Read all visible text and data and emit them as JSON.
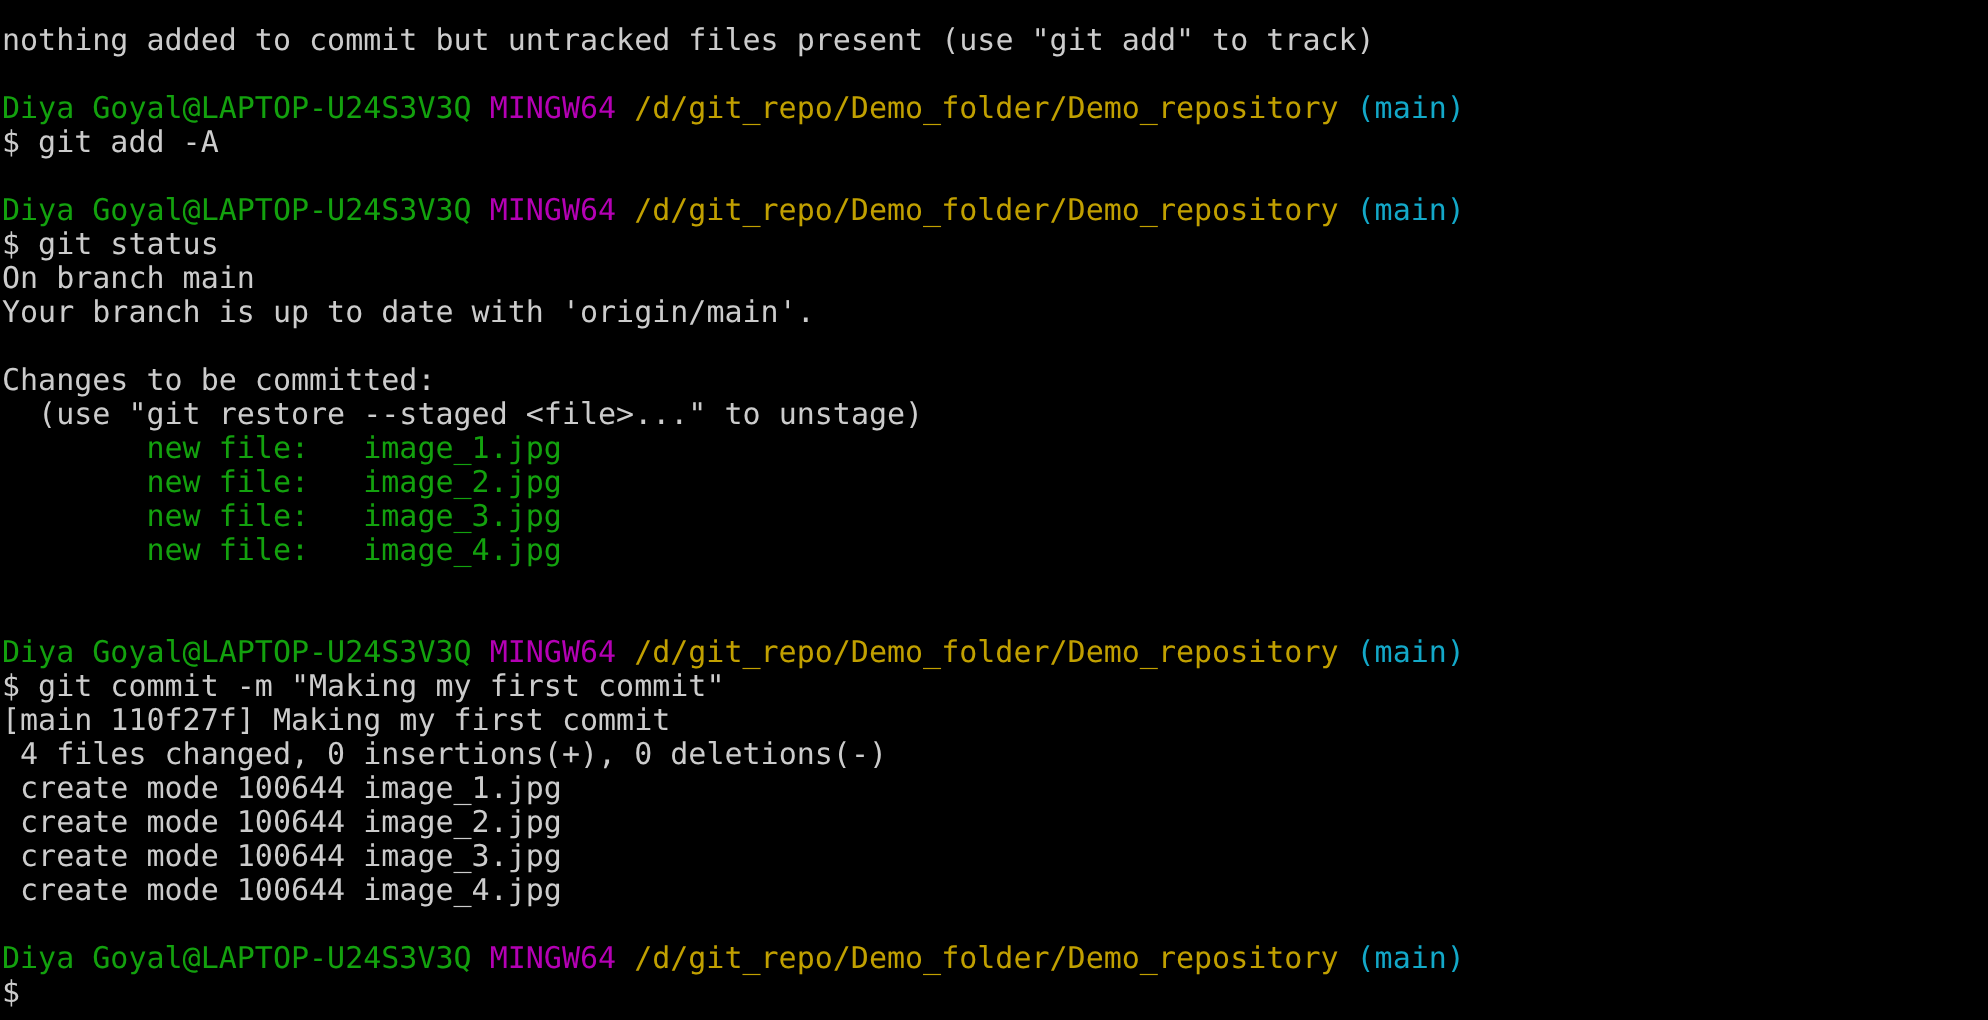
{
  "terminal": {
    "lines": [
      {
        "segments": [
          {
            "kind": "output",
            "text": "nothing added to commit but untracked files present (use \"git add\" to track)"
          }
        ]
      },
      {
        "kind": "blank"
      },
      {
        "segments": [
          {
            "kind": "user",
            "text": "Diya Goyal@LAPTOP-U24S3V3Q"
          },
          {
            "kind": "shell",
            "text": "MINGW64"
          },
          {
            "kind": "path",
            "text": "/d/git_repo/Demo_folder/Demo_repository"
          },
          {
            "kind": "branch",
            "text": "(main)"
          }
        ]
      },
      {
        "segments": [
          {
            "kind": "command",
            "text": "$ git add -A"
          }
        ]
      },
      {
        "kind": "blank"
      },
      {
        "segments": [
          {
            "kind": "user",
            "text": "Diya Goyal@LAPTOP-U24S3V3Q"
          },
          {
            "kind": "shell",
            "text": "MINGW64"
          },
          {
            "kind": "path",
            "text": "/d/git_repo/Demo_folder/Demo_repository"
          },
          {
            "kind": "branch",
            "text": "(main)"
          }
        ]
      },
      {
        "segments": [
          {
            "kind": "command",
            "text": "$ git status"
          }
        ]
      },
      {
        "segments": [
          {
            "kind": "output",
            "text": "On branch main"
          }
        ]
      },
      {
        "segments": [
          {
            "kind": "output",
            "text": "Your branch is up to date with 'origin/main'."
          }
        ]
      },
      {
        "kind": "blank"
      },
      {
        "segments": [
          {
            "kind": "output",
            "text": "Changes to be committed:"
          }
        ]
      },
      {
        "segments": [
          {
            "kind": "output",
            "text": "  (use \"git restore --staged <file>...\" to unstage)"
          }
        ]
      },
      {
        "segments": [
          {
            "kind": "staged",
            "text": "        new file:   image_1.jpg"
          }
        ]
      },
      {
        "segments": [
          {
            "kind": "staged",
            "text": "        new file:   image_2.jpg"
          }
        ]
      },
      {
        "segments": [
          {
            "kind": "staged",
            "text": "        new file:   image_3.jpg"
          }
        ]
      },
      {
        "segments": [
          {
            "kind": "staged",
            "text": "        new file:   image_4.jpg"
          }
        ]
      },
      {
        "kind": "blank"
      },
      {
        "kind": "blank"
      },
      {
        "segments": [
          {
            "kind": "user",
            "text": "Diya Goyal@LAPTOP-U24S3V3Q"
          },
          {
            "kind": "shell",
            "text": "MINGW64"
          },
          {
            "kind": "path",
            "text": "/d/git_repo/Demo_folder/Demo_repository"
          },
          {
            "kind": "branch",
            "text": "(main)"
          }
        ]
      },
      {
        "segments": [
          {
            "kind": "command",
            "text": "$ git commit -m \"Making my first commit\""
          }
        ]
      },
      {
        "segments": [
          {
            "kind": "output",
            "text": "[main 110f27f] Making my first commit"
          }
        ]
      },
      {
        "segments": [
          {
            "kind": "output",
            "text": " 4 files changed, 0 insertions(+), 0 deletions(-)"
          }
        ]
      },
      {
        "segments": [
          {
            "kind": "output",
            "text": " create mode 100644 image_1.jpg"
          }
        ]
      },
      {
        "segments": [
          {
            "kind": "output",
            "text": " create mode 100644 image_2.jpg"
          }
        ]
      },
      {
        "segments": [
          {
            "kind": "output",
            "text": " create mode 100644 image_3.jpg"
          }
        ]
      },
      {
        "segments": [
          {
            "kind": "output",
            "text": " create mode 100644 image_4.jpg"
          }
        ]
      },
      {
        "kind": "blank"
      },
      {
        "segments": [
          {
            "kind": "user",
            "text": "Diya Goyal@LAPTOP-U24S3V3Q"
          },
          {
            "kind": "shell",
            "text": "MINGW64"
          },
          {
            "kind": "path",
            "text": "/d/git_repo/Demo_folder/Demo_repository"
          },
          {
            "kind": "branch",
            "text": "(main)"
          }
        ]
      },
      {
        "segments": [
          {
            "kind": "command",
            "text": "$"
          }
        ]
      }
    ]
  }
}
